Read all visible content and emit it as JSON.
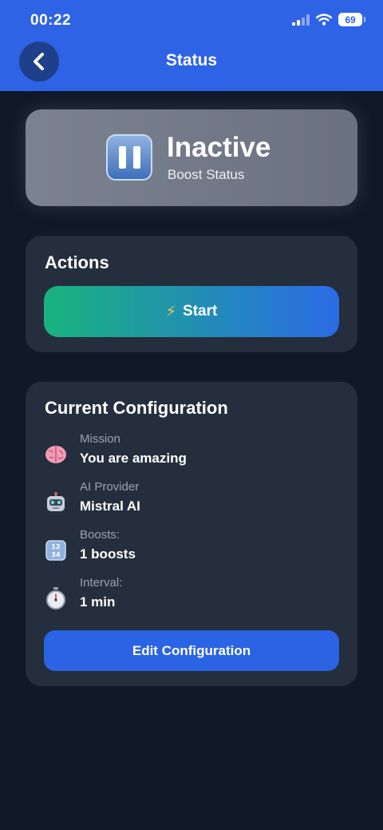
{
  "status_bar": {
    "time": "00:22",
    "battery": "69"
  },
  "header": {
    "title": "Status",
    "back_icon": "chevron-left-icon"
  },
  "status_card": {
    "state": "Inactive",
    "subtitle": "Boost Status",
    "icon": "pause-icon"
  },
  "actions": {
    "heading": "Actions",
    "start_icon": "⚡",
    "start_label": "Start"
  },
  "configuration": {
    "heading": "Current Configuration",
    "items": [
      {
        "icon": "brain-icon",
        "label": "Mission",
        "value": "You are amazing"
      },
      {
        "icon": "robot-icon",
        "label": "AI Provider",
        "value": "Mistral AI"
      },
      {
        "icon": "numbers-icon",
        "label": "Boosts:",
        "value": "1 boosts"
      },
      {
        "icon": "stopwatch-icon",
        "label": "Interval:",
        "value": "1 min"
      }
    ],
    "edit_label": "Edit Configuration"
  },
  "colors": {
    "header": "#2f63e6",
    "background": "#111827",
    "card": "#252e3d",
    "accent_green": "#19b37d",
    "accent_blue": "#2a63e3"
  }
}
